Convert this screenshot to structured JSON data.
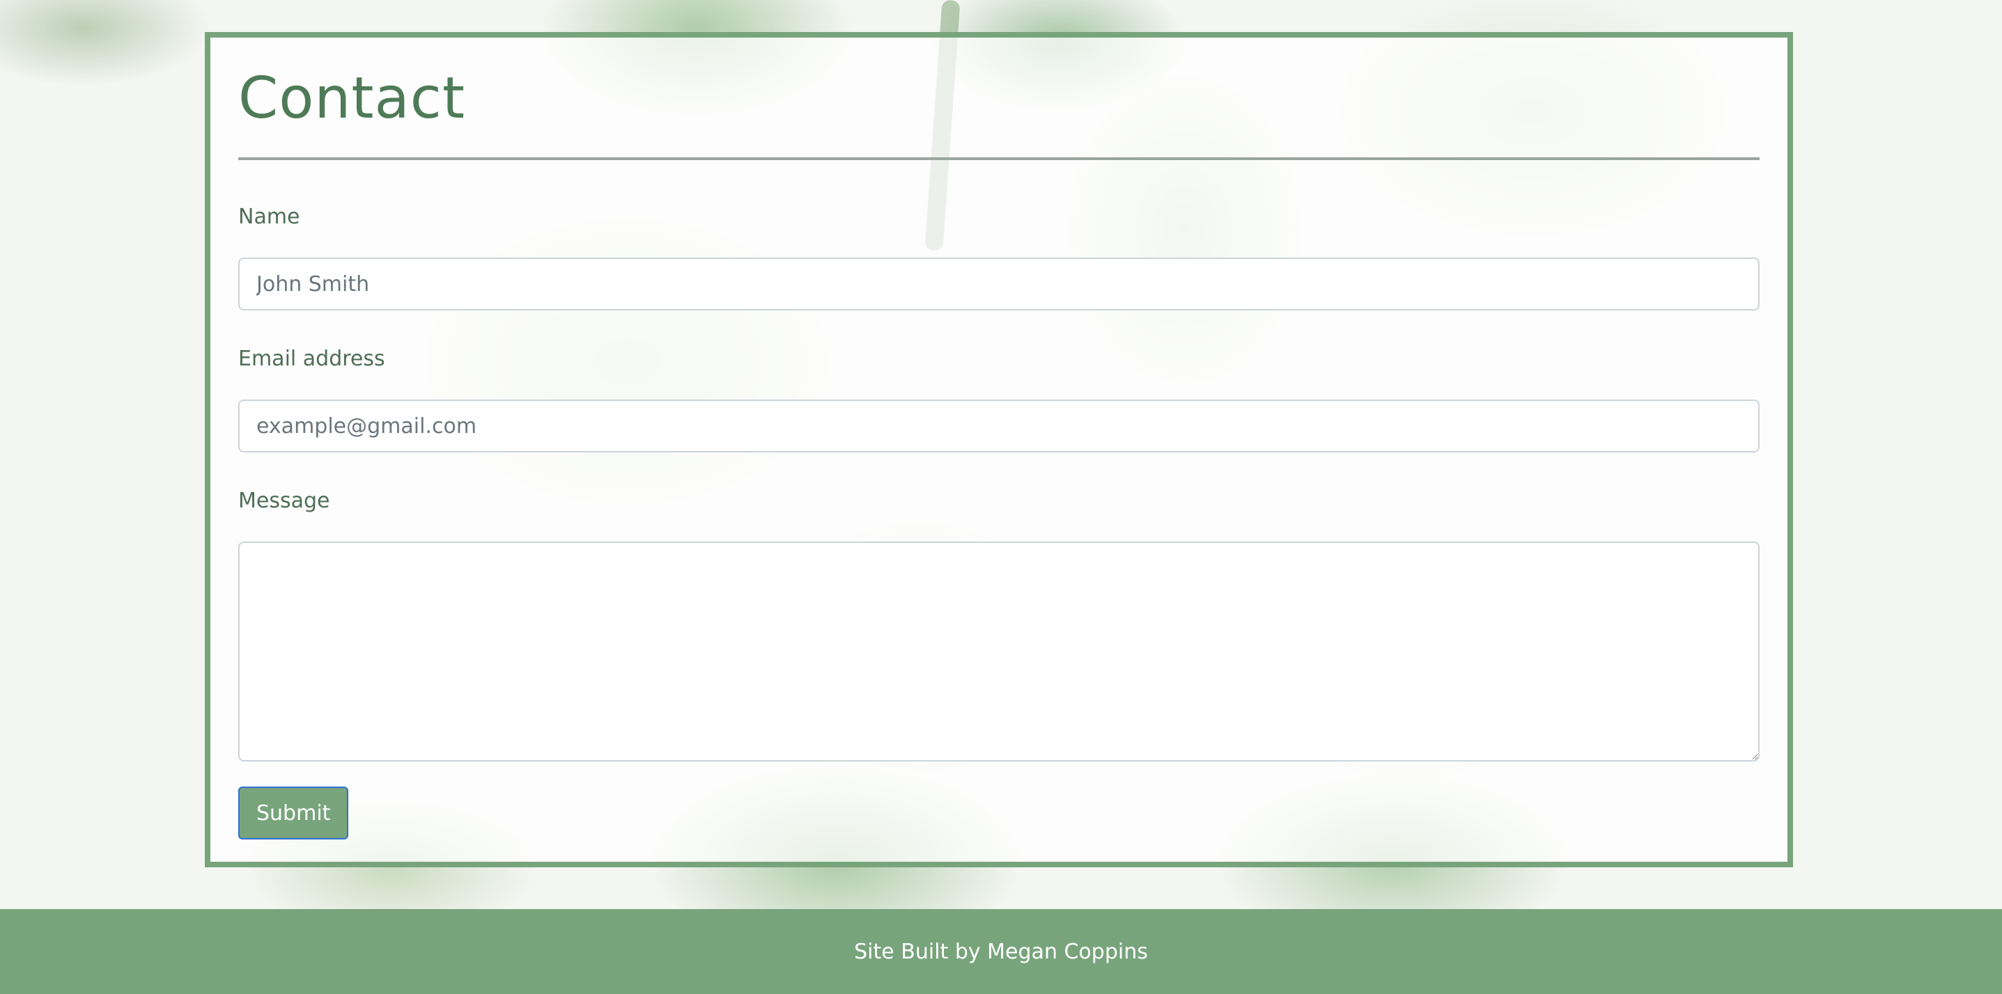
{
  "contact": {
    "title": "Contact",
    "name_label": "Name",
    "name_placeholder": "John Smith",
    "email_label": "Email address",
    "email_placeholder": "example@gmail.com",
    "message_label": "Message",
    "message_value": "",
    "submit_label": "Submit"
  },
  "footer": {
    "text": "Site Built by Megan Coppins"
  },
  "colors": {
    "accent": "#78a47c",
    "heading": "#4f7a58",
    "focus_border": "#2f6fd4"
  }
}
